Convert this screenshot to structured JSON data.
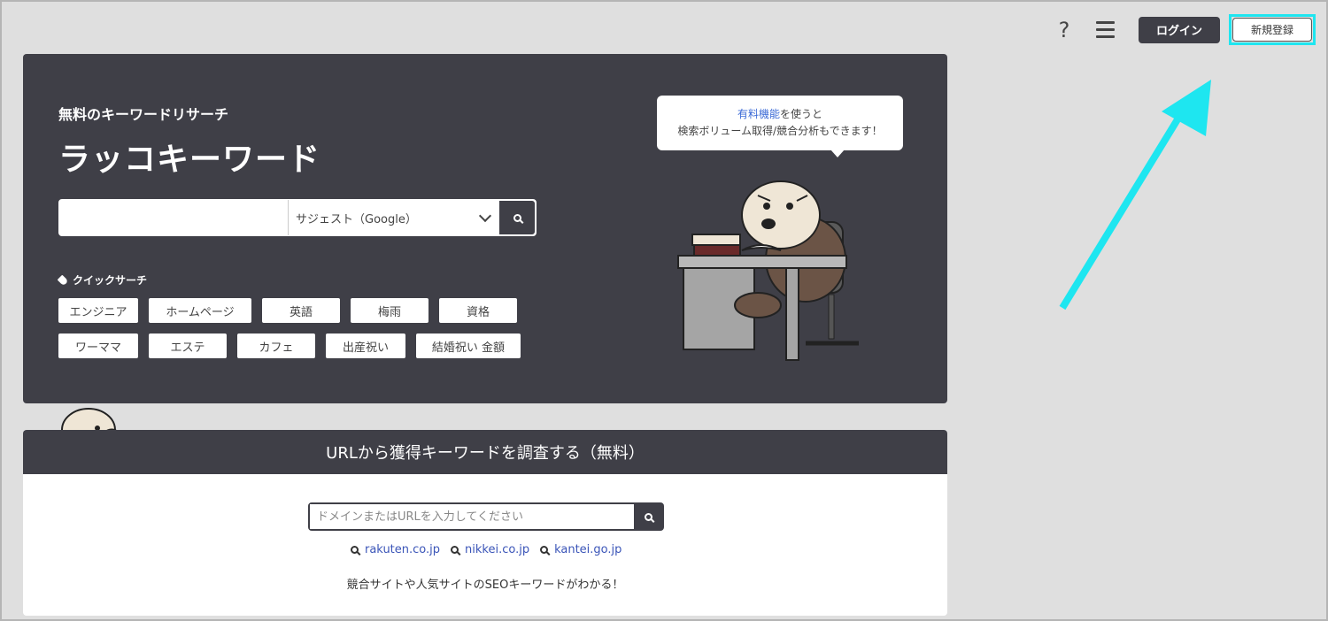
{
  "header": {
    "help_icon": "question-icon",
    "menu_icon": "hamburger-icon",
    "login_label": "ログイン",
    "signup_label": "新規登録"
  },
  "hero": {
    "subtitle": "無料のキーワードリサーチ",
    "title": "ラッコキーワード",
    "search": {
      "value": "",
      "placeholder": ""
    },
    "select_value": "サジェスト（Google）",
    "quick_search_label": "クイックサーチ",
    "quick_chips_row1": [
      "エンジニア",
      "ホームページ",
      "英語",
      "梅雨",
      "資格"
    ],
    "quick_chips_row2": [
      "ワーママ",
      "エステ",
      "カフェ",
      "出産祝い",
      "結婚祝い 金額"
    ],
    "bubble": {
      "link_text": "有料機能",
      "line1_rest": "を使うと",
      "line2": "検索ボリューム取得/競合分析もできます！"
    }
  },
  "url_section": {
    "title": "URLから獲得キーワードを調査する（無料）",
    "placeholder": "ドメインまたはURLを入力してください",
    "examples": [
      "rakuten.co.jp",
      "nikkei.co.jp",
      "kantei.go.jp"
    ],
    "note": "競合サイトや人気サイトのSEOキーワードがわかる！"
  },
  "annotation": {
    "highlight_color": "#1ee6f0"
  }
}
